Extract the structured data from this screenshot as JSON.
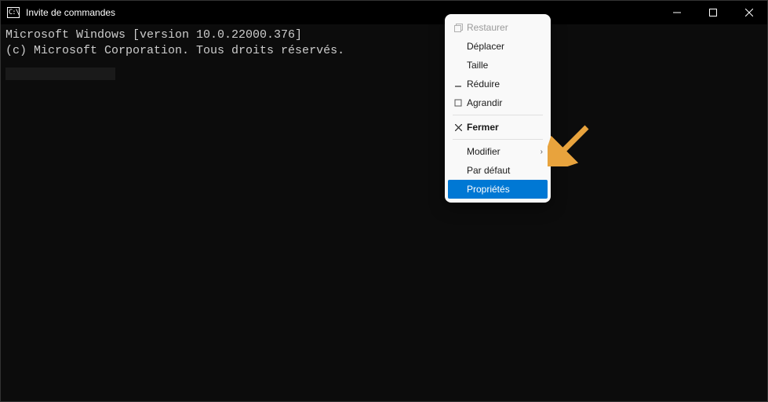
{
  "window": {
    "title": "Invite de commandes"
  },
  "terminal": {
    "line1": "Microsoft Windows [version 10.0.22000.376]",
    "line2": "(c) Microsoft Corporation. Tous droits réservés."
  },
  "menu": {
    "restore": "Restaurer",
    "move": "Déplacer",
    "size": "Taille",
    "minimize": "Réduire",
    "maximize": "Agrandir",
    "close": "Fermer",
    "modify": "Modifier",
    "defaults": "Par défaut",
    "properties": "Propriétés"
  }
}
